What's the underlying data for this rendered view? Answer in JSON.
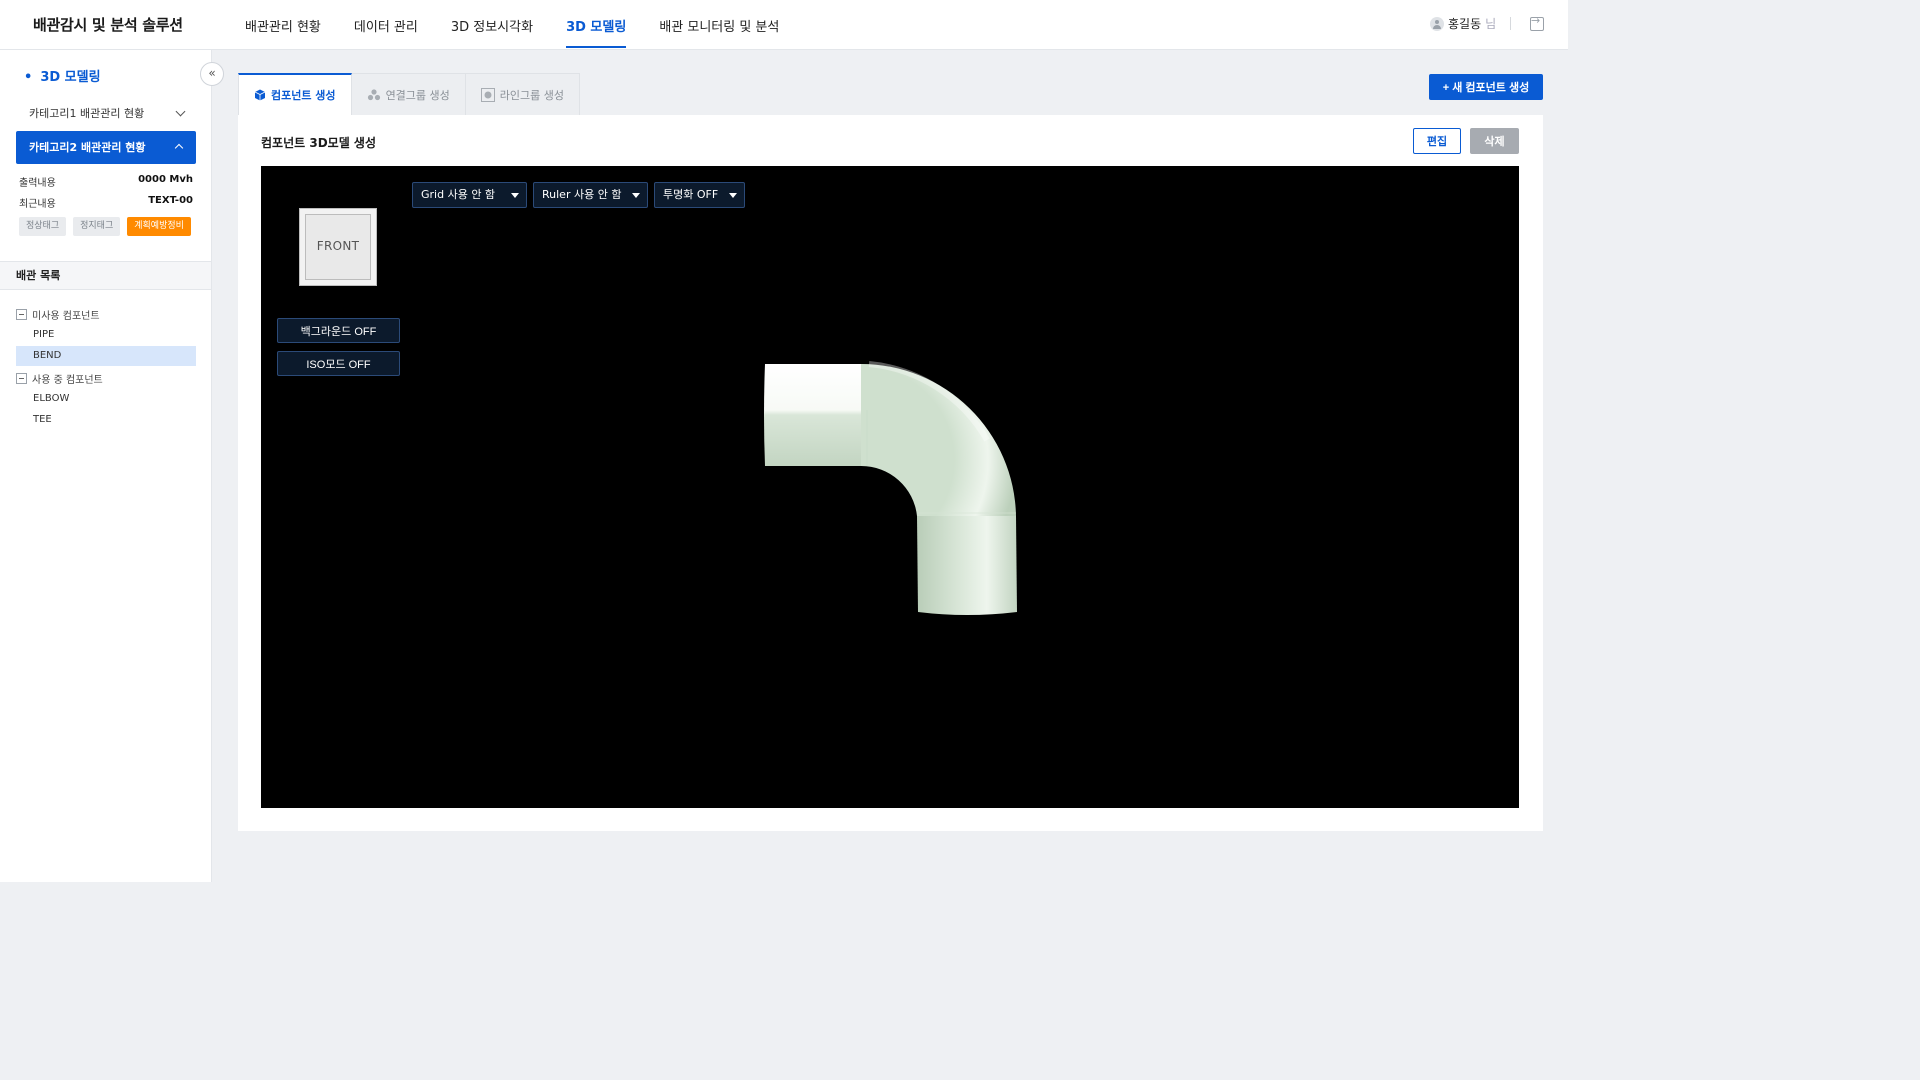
{
  "header": {
    "logo": "배관감시 및 분석 솔루션",
    "nav": [
      "배관관리 현황",
      "데이터 관리",
      "3D 정보시각화",
      "3D 모델링",
      "배관 모니터링 및 분석"
    ],
    "active_nav": "3D 모델링",
    "user_name": "홍길동",
    "user_suffix": "님"
  },
  "sidebar": {
    "title": "3D 모델링",
    "category1": "카테고리1 배관관리 현황",
    "category2": "카테고리2 배관관리 현황",
    "info": [
      {
        "label": "출력내용",
        "value": "0000 Mvh"
      },
      {
        "label": "최근내용",
        "value": "TEXT-00"
      }
    ],
    "tags": [
      "정상태그",
      "정지태그",
      "계획예방정비"
    ],
    "list_title": "배관 목록",
    "tree": {
      "unused_group": "미사용 컴포넌트",
      "unused_items": [
        "PIPE",
        "BEND"
      ],
      "used_group": "사용 중 컴포넌트",
      "used_items": [
        "ELBOW",
        "TEE"
      ],
      "selected": "BEND"
    }
  },
  "tabs": [
    "컴포넌트 생성",
    "연결그룹 생성",
    "라인그룹 생성"
  ],
  "active_tab": "컴포넌트 생성",
  "new_button": "+ 새 컴포넌트 생성",
  "panel": {
    "title": "컴포넌트 3D모델 생성",
    "edit": "편집",
    "delete": "삭제"
  },
  "viewer": {
    "viewcube_label": "FRONT",
    "background_toggle": "백그라운드 OFF",
    "iso_toggle": "ISO모드 OFF",
    "grid_select": "Grid 사용 안 함",
    "ruler_select": "Ruler 사용 안 함",
    "transparency_select": "투명화 OFF"
  },
  "colors": {
    "accent": "#0a5bd3",
    "tag_orange": "#ff8a00",
    "viewport_bg": "#000000",
    "pipe": "#c9dcc8"
  }
}
